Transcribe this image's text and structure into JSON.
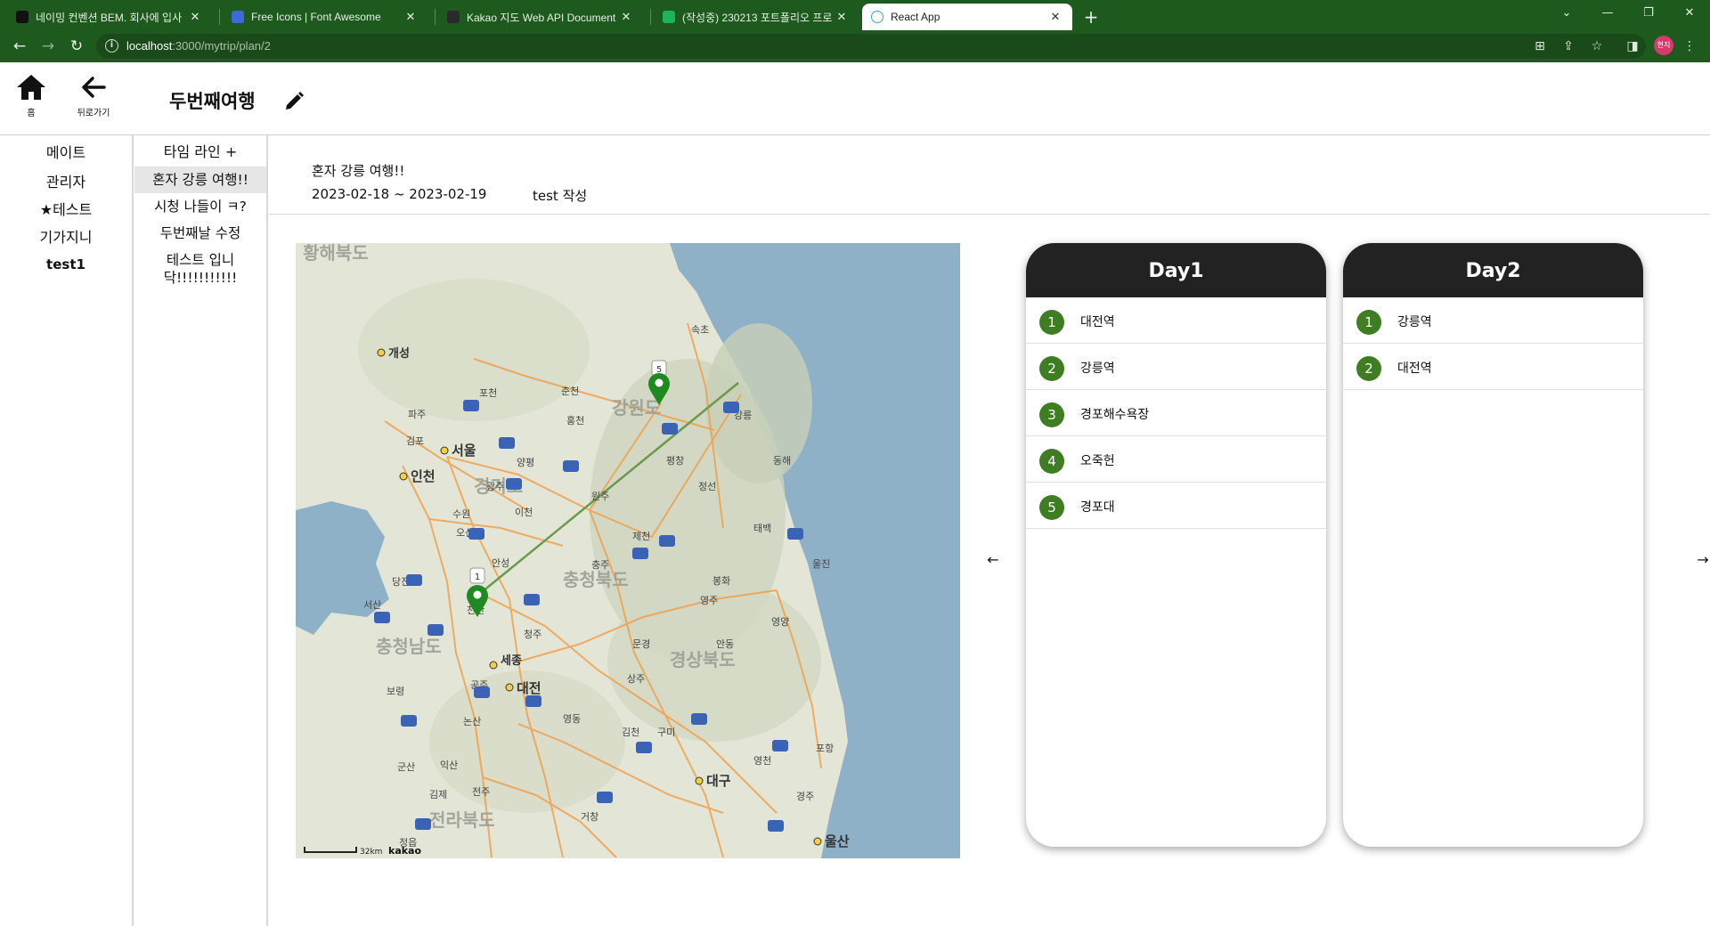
{
  "browser": {
    "tabs": [
      {
        "title": "네이밍 컨벤션 BEM. 회사에 입사",
        "color": "#111111"
      },
      {
        "title": "Free Icons | Font Awesome",
        "color": "#3f6ad8"
      },
      {
        "title": "Kakao 지도 Web API Document",
        "color": "#222222"
      },
      {
        "title": "(작성중) 230213 포트폴리오 프로",
        "color": "#1db45e"
      },
      {
        "title": "React App",
        "color": "#61dafb"
      }
    ],
    "url_host": "localhost",
    "url_path": ":3000/mytrip/plan/2",
    "profile_label": "현지"
  },
  "header": {
    "home_label": "홈",
    "back_label": "뒤로가기",
    "trip_title": "두번째여행"
  },
  "mates": {
    "heading": "메이트",
    "items": [
      "관리자",
      "★테스트",
      "기가지니",
      "test1"
    ]
  },
  "timeline": {
    "heading": "타임 라인 +",
    "items": [
      "혼자 강릉 여행!!",
      "시청 나들이 ㅋ?",
      "두번째날 수정",
      "테스트 입니닥!!!!!!!!!!!"
    ]
  },
  "plan": {
    "title": "혼자 강릉 여행!!",
    "dates": "2023-02-18 ~ 2023-02-19",
    "author": "test 작성"
  },
  "map": {
    "labels": {
      "hwanghae": "황해북도",
      "gangwon": "강원도",
      "gyeonggi": "경기도",
      "chungbuk": "충청북도",
      "chungnam": "충청남도",
      "gyeongbuk": "경상북도",
      "jeonbuk": "전라북도",
      "seoul": "서울",
      "incheon": "인천",
      "gaeseong": "개성",
      "daejeon": "대전",
      "daegu": "대구",
      "ulsan": "울산",
      "sejong": "세종",
      "sokcho": "속초",
      "gangneung": "강릉",
      "donghae": "동해",
      "taebaek": "태백",
      "wonju": "원주",
      "chuncheon": "춘천",
      "chungju": "충주",
      "jecheon": "제천",
      "cheongju": "청주",
      "andong": "안동",
      "sangju": "상주",
      "gumi": "구미",
      "gimcheon": "김천",
      "yeongju": "영주",
      "pohang": "포항",
      "gyeongju": "경주",
      "yeongcheon": "영천",
      "suwon": "수원",
      "icheon": "이천",
      "gimpo": "김포",
      "paju": "파주",
      "pocheon": "포천",
      "cheonan": "천안",
      "gongju": "공주",
      "nonsan": "논산",
      "iksan": "익산",
      "gunsan": "군산",
      "jeonju": "전주",
      "gimje": "김제",
      "jeongeup": "정읍",
      "boryeong": "보령",
      "seosan": "서산",
      "dangjin": "당진",
      "mungyeong": "문경",
      "yeongdong": "영동",
      "geochang": "거창",
      "uljin": "울진",
      "bonghwa": "봉화",
      "yeongyang": "영양",
      "pyeongchang": "평창",
      "jeongseon": "정선",
      "hongcheon": "홍천",
      "yangpyeong": "양평",
      "gwangju": "광주",
      "osan": "오산",
      "anseong": "안성"
    },
    "markers": [
      "1",
      "5"
    ],
    "scale_label": "32km",
    "brand": "kakao"
  },
  "days": [
    {
      "title": "Day1",
      "stops": [
        {
          "num": "1",
          "name": "대전역"
        },
        {
          "num": "2",
          "name": "강릉역"
        },
        {
          "num": "3",
          "name": "경포해수욕장"
        },
        {
          "num": "4",
          "name": "오죽헌"
        },
        {
          "num": "5",
          "name": "경포대"
        }
      ]
    },
    {
      "title": "Day2",
      "stops": [
        {
          "num": "1",
          "name": "강릉역"
        },
        {
          "num": "2",
          "name": "대전역"
        }
      ]
    }
  ],
  "colors": {
    "browser_chrome": "#1e5a1e",
    "marker": "#1f8a1f",
    "route": "#6a9a4a",
    "badge": "#3f7d23",
    "day_header": "#222222"
  }
}
